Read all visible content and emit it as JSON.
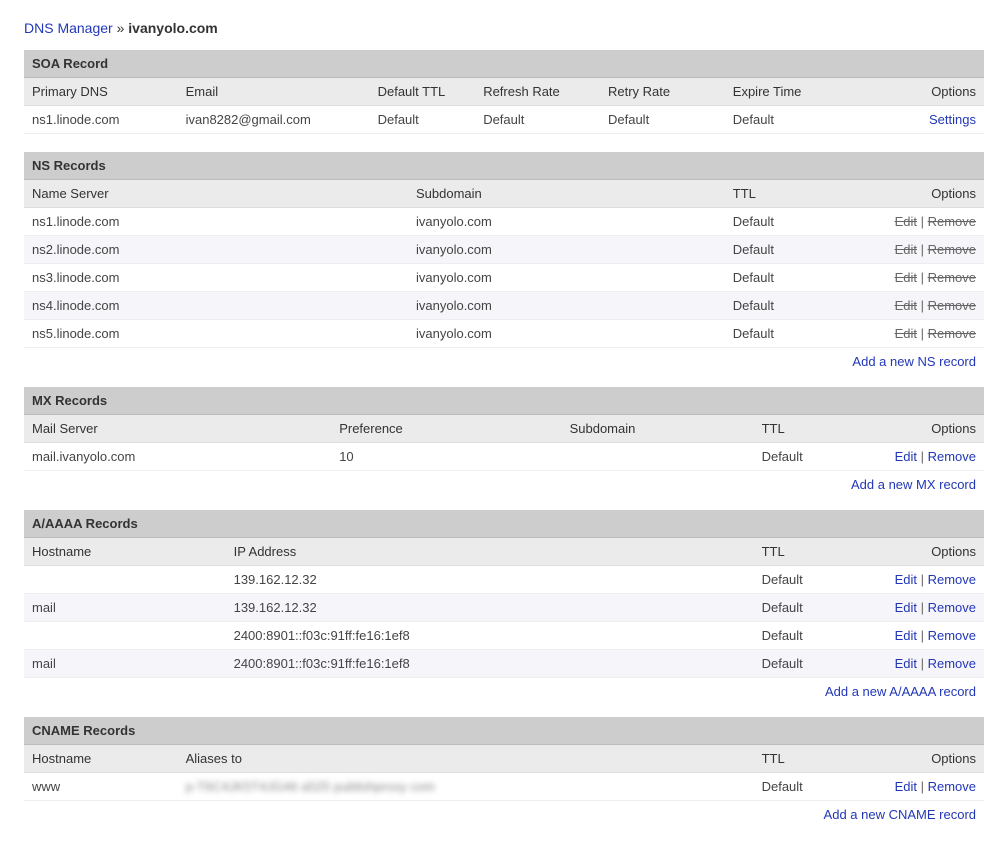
{
  "breadcrumb": {
    "root": "DNS Manager",
    "separator": "»",
    "current": "ivanyolo.com"
  },
  "soa": {
    "title": "SOA Record",
    "headers": {
      "primary": "Primary DNS",
      "email": "Email",
      "default_ttl": "Default TTL",
      "refresh": "Refresh Rate",
      "retry": "Retry Rate",
      "expire": "Expire Time",
      "options": "Options"
    },
    "row": {
      "primary": "ns1.linode.com",
      "email": "ivan8282@gmail.com",
      "default_ttl": "Default",
      "refresh": "Default",
      "retry": "Default",
      "expire": "Default",
      "settings_label": "Settings"
    }
  },
  "ns": {
    "title": "NS Records",
    "headers": {
      "name": "Name Server",
      "sub": "Subdomain",
      "ttl": "TTL",
      "options": "Options"
    },
    "rows": [
      {
        "name": "ns1.linode.com",
        "sub": "ivanyolo.com",
        "ttl": "Default"
      },
      {
        "name": "ns2.linode.com",
        "sub": "ivanyolo.com",
        "ttl": "Default"
      },
      {
        "name": "ns3.linode.com",
        "sub": "ivanyolo.com",
        "ttl": "Default"
      },
      {
        "name": "ns4.linode.com",
        "sub": "ivanyolo.com",
        "ttl": "Default"
      },
      {
        "name": "ns5.linode.com",
        "sub": "ivanyolo.com",
        "ttl": "Default"
      }
    ],
    "edit": "Edit",
    "remove": "Remove",
    "add": "Add a new NS record"
  },
  "mx": {
    "title": "MX Records",
    "headers": {
      "mail": "Mail Server",
      "pref": "Preference",
      "sub": "Subdomain",
      "ttl": "TTL",
      "options": "Options"
    },
    "rows": [
      {
        "mail": "mail.ivanyolo.com",
        "pref": "10",
        "sub": "",
        "ttl": "Default"
      }
    ],
    "edit": "Edit",
    "remove": "Remove",
    "add": "Add a new MX record"
  },
  "a": {
    "title": "A/AAAA Records",
    "headers": {
      "host": "Hostname",
      "ip": "IP Address",
      "ttl": "TTL",
      "options": "Options"
    },
    "rows": [
      {
        "host": "",
        "ip": "139.162.12.32",
        "ttl": "Default"
      },
      {
        "host": "mail",
        "ip": "139.162.12.32",
        "ttl": "Default"
      },
      {
        "host": "",
        "ip": "2400:8901::f03c:91ff:fe16:1ef8",
        "ttl": "Default"
      },
      {
        "host": "mail",
        "ip": "2400:8901::f03c:91ff:fe16:1ef8",
        "ttl": "Default"
      }
    ],
    "edit": "Edit",
    "remove": "Remove",
    "add": "Add a new A/AAAA record"
  },
  "cname": {
    "title": "CNAME Records",
    "headers": {
      "host": "Hostname",
      "alias": "Aliases to",
      "ttl": "TTL",
      "options": "Options"
    },
    "rows": [
      {
        "host": "www",
        "alias": "p-T6C4JK5T4JG46 a525 publishproxy com",
        "ttl": "Default"
      }
    ],
    "edit": "Edit",
    "remove": "Remove",
    "add": "Add a new CNAME record"
  }
}
